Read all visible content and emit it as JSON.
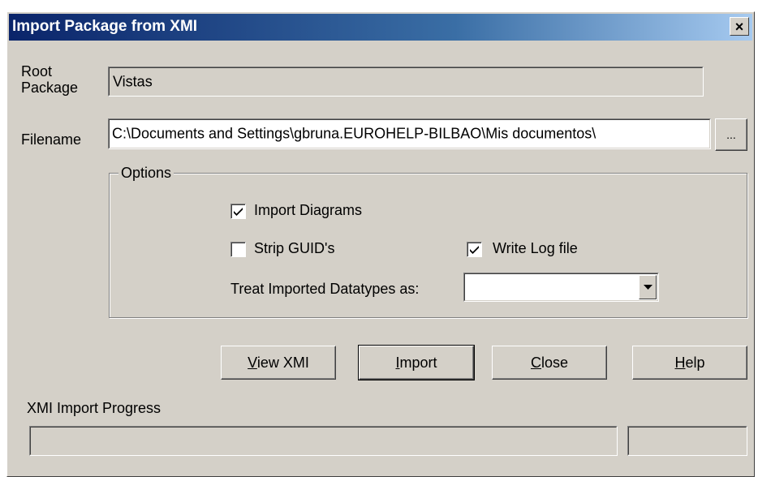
{
  "window": {
    "title": "Import Package from XMI",
    "close_label": "×"
  },
  "form": {
    "root_package_label_line1": "Root",
    "root_package_label_line2": "Package",
    "root_package_value": "Vistas",
    "filename_label": "Filename",
    "filename_value": "C:\\Documents and Settings\\gbruna.EUROHELP-BILBAO\\Mis documentos\\",
    "browse_label": "..."
  },
  "options": {
    "group_title": "Options",
    "import_diagrams": {
      "label": "Import Diagrams",
      "checked": true
    },
    "strip_guids": {
      "label": "Strip GUID's",
      "checked": false
    },
    "write_log_file": {
      "label": "Write Log file",
      "checked": true
    },
    "datatypes_label": "Treat Imported Datatypes as:",
    "datatypes_value": ""
  },
  "buttons": {
    "view_xmi_mnemonic": "V",
    "view_xmi_rest": "iew XMI",
    "import_mnemonic": "I",
    "import_rest": "mport",
    "close_mnemonic": "C",
    "close_rest": "lose",
    "help_mnemonic": "H",
    "help_rest": "elp"
  },
  "progress": {
    "label": "XMI Import Progress",
    "value": 0
  },
  "icons": {
    "close": "close-icon",
    "checkmark": "checkmark-icon",
    "dropdown": "chevron-down-icon"
  }
}
